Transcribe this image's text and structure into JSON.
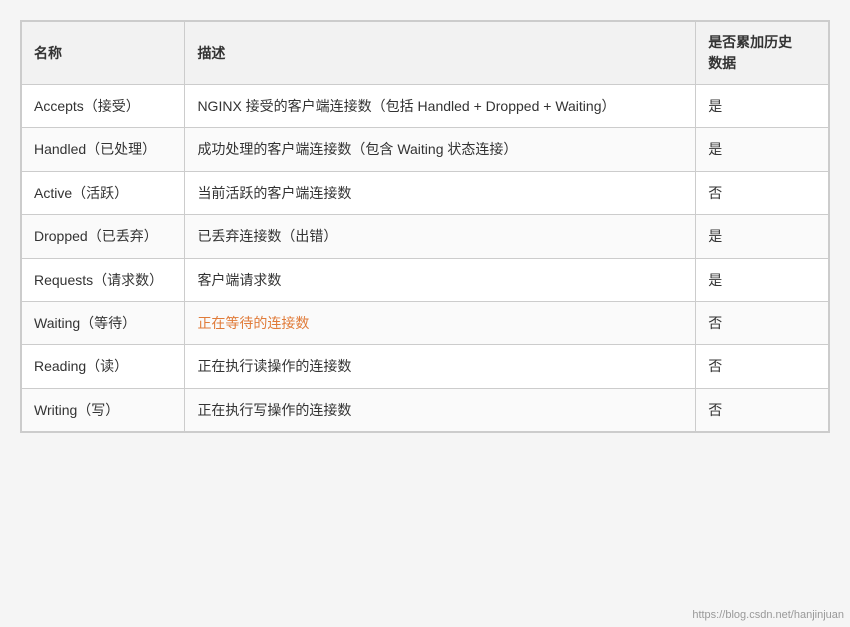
{
  "table": {
    "headers": {
      "name": "名称",
      "desc": "描述",
      "hist": "是否累加历史\n数据"
    },
    "rows": [
      {
        "name": "Accepts（接受）",
        "desc": "NGINX 接受的客户端连接数（包括 Handled + Dropped + Waiting）",
        "hist": "是",
        "link": false
      },
      {
        "name": "Handled（已处理）",
        "desc": "成功处理的客户端连接数（包含 Waiting 状态连接）",
        "hist": "是",
        "link": false
      },
      {
        "name": "Active（活跃）",
        "desc": "当前活跃的客户端连接数",
        "hist": "否",
        "link": false
      },
      {
        "name": "Dropped（已丢弃）",
        "desc": "已丢弃连接数（出错）",
        "hist": "是",
        "link": false
      },
      {
        "name": "Requests（请求数）",
        "desc": "客户端请求数",
        "hist": "是",
        "link": false
      },
      {
        "name": "Waiting（等待）",
        "desc": "正在等待的连接数",
        "hist": "否",
        "link": true
      },
      {
        "name": "Reading（读）",
        "desc": "正在执行读操作的连接数",
        "hist": "否",
        "link": false
      },
      {
        "name": "Writing（写）",
        "desc": "正在执行写操作的连接数",
        "hist": "否",
        "link": false
      }
    ]
  },
  "watermark": "https://blog.csdn.net/hanjinjuan"
}
